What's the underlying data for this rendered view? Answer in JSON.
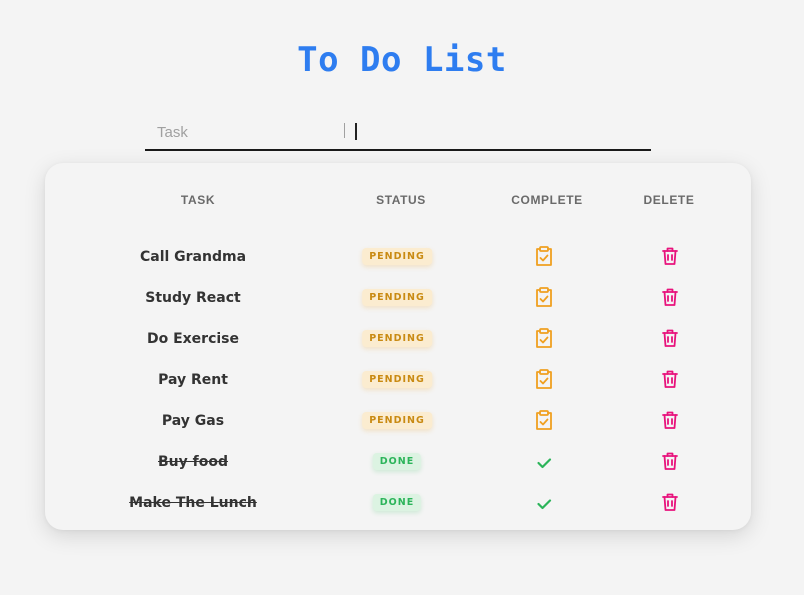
{
  "title": "To Do List",
  "input": {
    "placeholder": "Task",
    "value": ""
  },
  "table": {
    "headers": {
      "task": "TASK",
      "status": "STATUS",
      "complete": "COMPLETE",
      "delete": "DELETE"
    },
    "rows": [
      {
        "task": "Call Grandma",
        "status": "PENDING",
        "done": false
      },
      {
        "task": "Study React",
        "status": "PENDING",
        "done": false
      },
      {
        "task": "Do Exercise",
        "status": "PENDING",
        "done": false
      },
      {
        "task": "Pay Rent",
        "status": "PENDING",
        "done": false
      },
      {
        "task": "Pay Gas",
        "status": "PENDING",
        "done": false
      },
      {
        "task": "Buy food",
        "status": "DONE",
        "done": true
      },
      {
        "task": "Make The Lunch",
        "status": "DONE",
        "done": true
      }
    ]
  },
  "icons": {
    "complete_pending": "clipboard-check-icon",
    "complete_done": "checkmark-icon",
    "delete": "trash-icon"
  },
  "colors": {
    "title": "#2e7df0",
    "pending": "#f0a020",
    "done": "#2cb45a",
    "delete": "#e8127c"
  }
}
